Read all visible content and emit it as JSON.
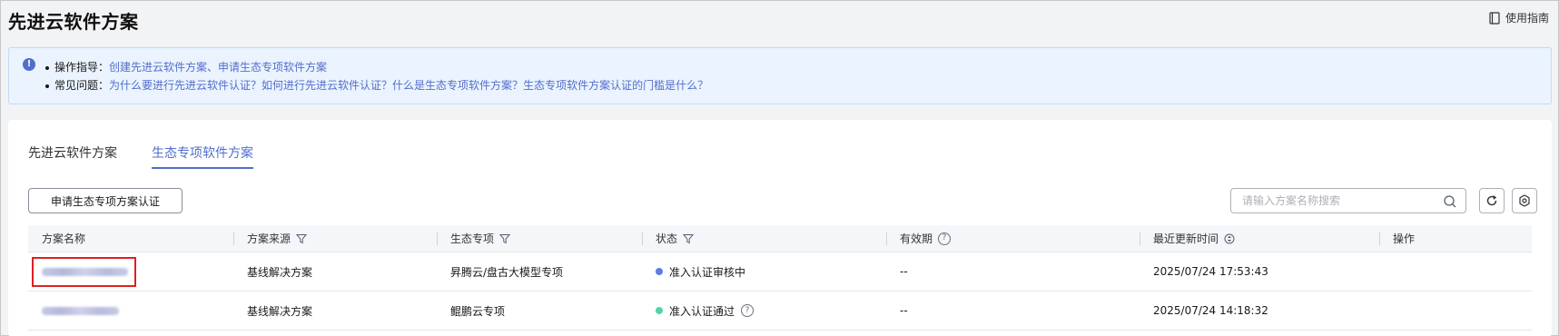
{
  "page": {
    "title": "先进云软件方案",
    "guide_label": "使用指南"
  },
  "info": {
    "line1_label": "操作指导：",
    "line1_link": "创建先进云软件方案、申请生态专项软件方案",
    "line2_label": "常见问题：",
    "line2_links": [
      "为什么要进行先进云软件认证？",
      "如何进行先进云软件认证？",
      "什么是生态专项软件方案？",
      "生态专项软件方案认证的门槛是什么？"
    ]
  },
  "tabs": [
    {
      "label": "先进云软件方案",
      "active": false
    },
    {
      "label": "生态专项软件方案",
      "active": true
    }
  ],
  "toolbar": {
    "apply_label": "申请生态专项方案认证",
    "search_placeholder": "请输入方案名称搜索"
  },
  "table": {
    "headers": [
      "方案名称",
      "方案来源",
      "生态专项",
      "状态",
      "有效期",
      "最近更新时间",
      "操作"
    ],
    "rows": [
      {
        "source": "基线解决方案",
        "ecosystem": "昇腾云/盘古大模型专项",
        "status": "准入认证审核中",
        "validity": "--",
        "updated": "2025/07/24 17:53:43",
        "highlighted": true
      },
      {
        "source": "基线解决方案",
        "ecosystem": "鲲鹏云专项",
        "status": "准入认证通过",
        "validity": "--",
        "updated": "2025/07/24 14:18:32",
        "highlighted": false
      }
    ]
  },
  "colors": {
    "link": "#526ecc",
    "status_pending": "#5e7ce0",
    "status_passed": "#50d4ab",
    "highlight_box": "#e02020"
  }
}
